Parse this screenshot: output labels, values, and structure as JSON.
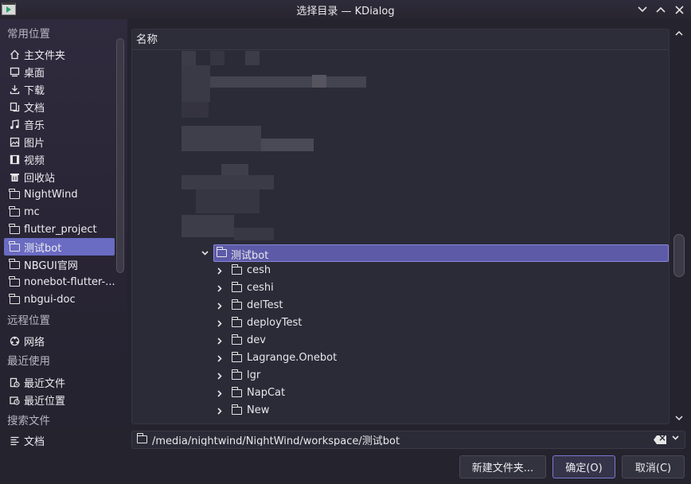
{
  "window": {
    "title": "选择目录 — KDialog",
    "controls": [
      "chevron-down",
      "chevron-up",
      "close"
    ]
  },
  "places": {
    "sections": [
      {
        "title": "常用位置",
        "items": [
          {
            "label": "主文件夹",
            "icon": "home-icon"
          },
          {
            "label": "桌面",
            "icon": "desktop-icon"
          },
          {
            "label": "下载",
            "icon": "download-icon"
          },
          {
            "label": "文档",
            "icon": "document-icon"
          },
          {
            "label": "音乐",
            "icon": "music-icon"
          },
          {
            "label": "图片",
            "icon": "image-icon"
          },
          {
            "label": "视频",
            "icon": "video-icon"
          },
          {
            "label": "回收站",
            "icon": "trash-icon"
          },
          {
            "label": "NightWind",
            "icon": "folder-icon"
          },
          {
            "label": "mc",
            "icon": "folder-icon"
          },
          {
            "label": "flutter_project",
            "icon": "folder-icon"
          },
          {
            "label": "测试bot",
            "icon": "folder-icon",
            "selected": true
          },
          {
            "label": "NBGUI官网",
            "icon": "folder-icon"
          },
          {
            "label": "nonebot-flutter-...",
            "icon": "folder-icon"
          },
          {
            "label": "nbgui-doc",
            "icon": "folder-icon"
          }
        ]
      },
      {
        "title": "远程位置",
        "items": [
          {
            "label": "网络",
            "icon": "network-icon"
          }
        ]
      },
      {
        "title": "最近使用",
        "items": [
          {
            "label": "最近文件",
            "icon": "recent-files-icon"
          },
          {
            "label": "最近位置",
            "icon": "recent-locations-icon"
          }
        ]
      },
      {
        "title": "搜索文件",
        "items": [
          {
            "label": "文档",
            "icon": "search-documents-icon"
          }
        ]
      }
    ]
  },
  "tree": {
    "header": "名称",
    "selected_folder": "测试bot",
    "children": [
      "cesh",
      "ceshi",
      "delTest",
      "deployTest",
      "dev",
      "Lagrange.Onebot",
      "lgr",
      "NapCat",
      "New"
    ]
  },
  "pathbar": {
    "value": "/media/nightwind/NightWind/workspace/测试bot"
  },
  "buttons": {
    "new_folder": "新建文件夹...",
    "ok": "确定(O)",
    "cancel": "取消(C)"
  },
  "colors": {
    "accent": "#6a6bc2",
    "background": "#24232e",
    "panel": "#2b2a37"
  }
}
